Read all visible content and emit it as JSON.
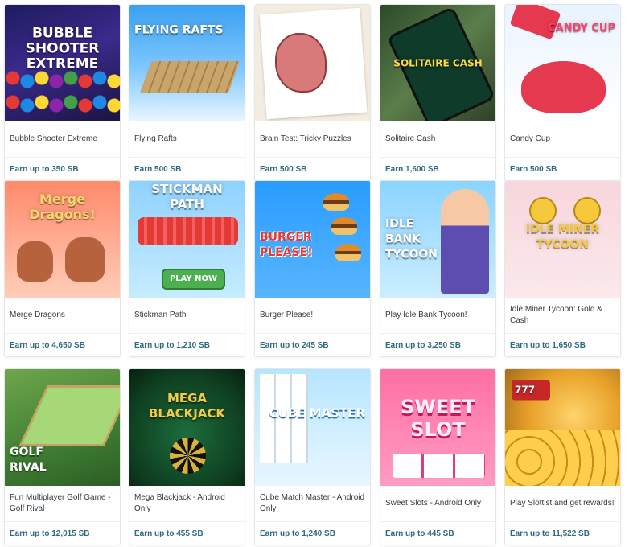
{
  "games": [
    {
      "name": "Bubble Shooter Extreme",
      "thumb_text": "Bubble Shooter Extreme",
      "reward": "Earn up to 350 SB"
    },
    {
      "name": "Flying Rafts",
      "thumb_text": "Flying Rafts",
      "reward": "Earn 500 SB"
    },
    {
      "name": "Brain Test: Tricky Puzzles",
      "thumb_text": "",
      "reward": "Earn 500 SB"
    },
    {
      "name": "Solitaire Cash",
      "thumb_text": "Solitaire Cash",
      "reward": "Earn 1,600 SB"
    },
    {
      "name": "Candy Cup",
      "thumb_text": "Candy Cup",
      "reward": "Earn 500 SB"
    },
    {
      "name": "Merge Dragons",
      "thumb_text": "Merge Dragons!",
      "reward": "Earn up to 4,650 SB"
    },
    {
      "name": "Stickman Path",
      "thumb_text": "Stickman Path",
      "play_now": "PLAY NOW",
      "reward": "Earn up to 1,210 SB"
    },
    {
      "name": "Burger Please!",
      "thumb_text": "Burger Please!",
      "reward": "Earn up to 245 SB"
    },
    {
      "name": "Play Idle Bank Tycoon!",
      "thumb_text": "Idle Bank Tycoon",
      "reward": "Earn up to 3,250 SB"
    },
    {
      "name": "Idle Miner Tycoon: Gold & Cash",
      "thumb_text": "Idle Miner Tycoon",
      "reward": "Earn up to 1,650 SB"
    },
    {
      "name": "Fun Multiplayer Golf Game - Golf Rival",
      "thumb_text": "Golf Rival",
      "reward": "Earn up to 12,015 SB"
    },
    {
      "name": "Mega Blackjack - Android Only",
      "thumb_text": "Mega Blackjack",
      "reward": "Earn up to 455 SB"
    },
    {
      "name": "Cube Match Master - Android Only",
      "thumb_text": "Cube Master",
      "reward": "Earn up to 1,240 SB"
    },
    {
      "name": "Sweet Slots - Android Only",
      "thumb_text": "Sweet Slot",
      "reward": "Earn up to 445 SB"
    },
    {
      "name": "Play Slottist and get rewards!",
      "thumb_text": "777",
      "reward": "Earn up to 11,522 SB"
    }
  ],
  "colors": {
    "reward_text": "#2f6a7e",
    "name_text": "#333a40",
    "card_border": "#e4e7ea"
  }
}
